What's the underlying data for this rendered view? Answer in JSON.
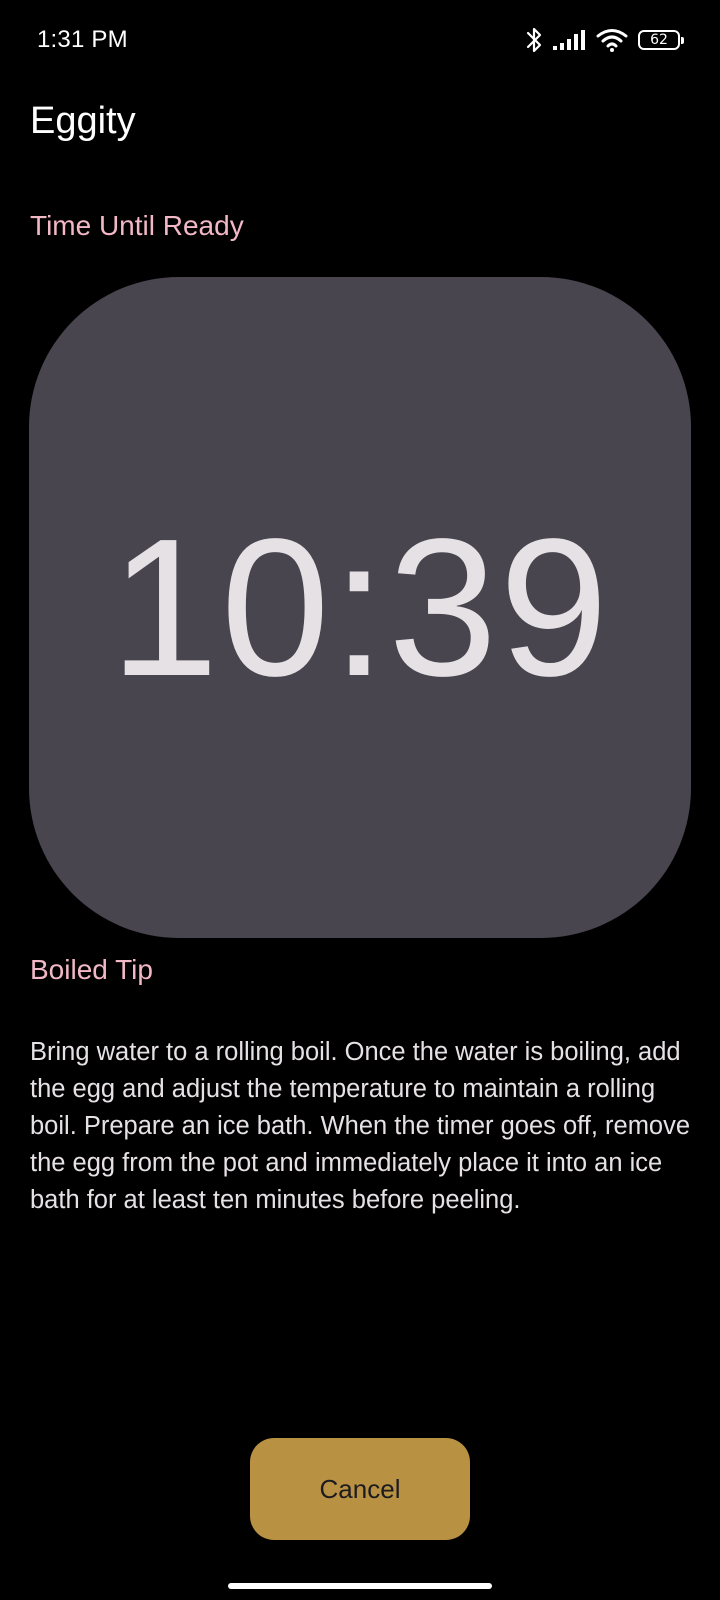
{
  "status_bar": {
    "time": "1:31 PM",
    "battery_level": "62",
    "icons": [
      "bluetooth-icon",
      "signal-icon",
      "wifi-icon",
      "battery-icon"
    ]
  },
  "app": {
    "title": "Eggity"
  },
  "timer": {
    "label": "Time Until Ready",
    "value": "10:39"
  },
  "tip": {
    "label": "Boiled Tip",
    "text": "Bring water to a rolling boil. Once the water is boiling, add the egg and adjust the temperature to maintain a rolling boil. Prepare an ice bath. When the timer goes off, remove the egg from the pot and immediately place it into an ice bath for at least ten minutes before peeling."
  },
  "actions": {
    "cancel_label": "Cancel"
  },
  "colors": {
    "background": "#000000",
    "accent_pink": "#f2b8c6",
    "card": "#49454f",
    "button": "#b99143",
    "text": "#e6e1e5"
  }
}
